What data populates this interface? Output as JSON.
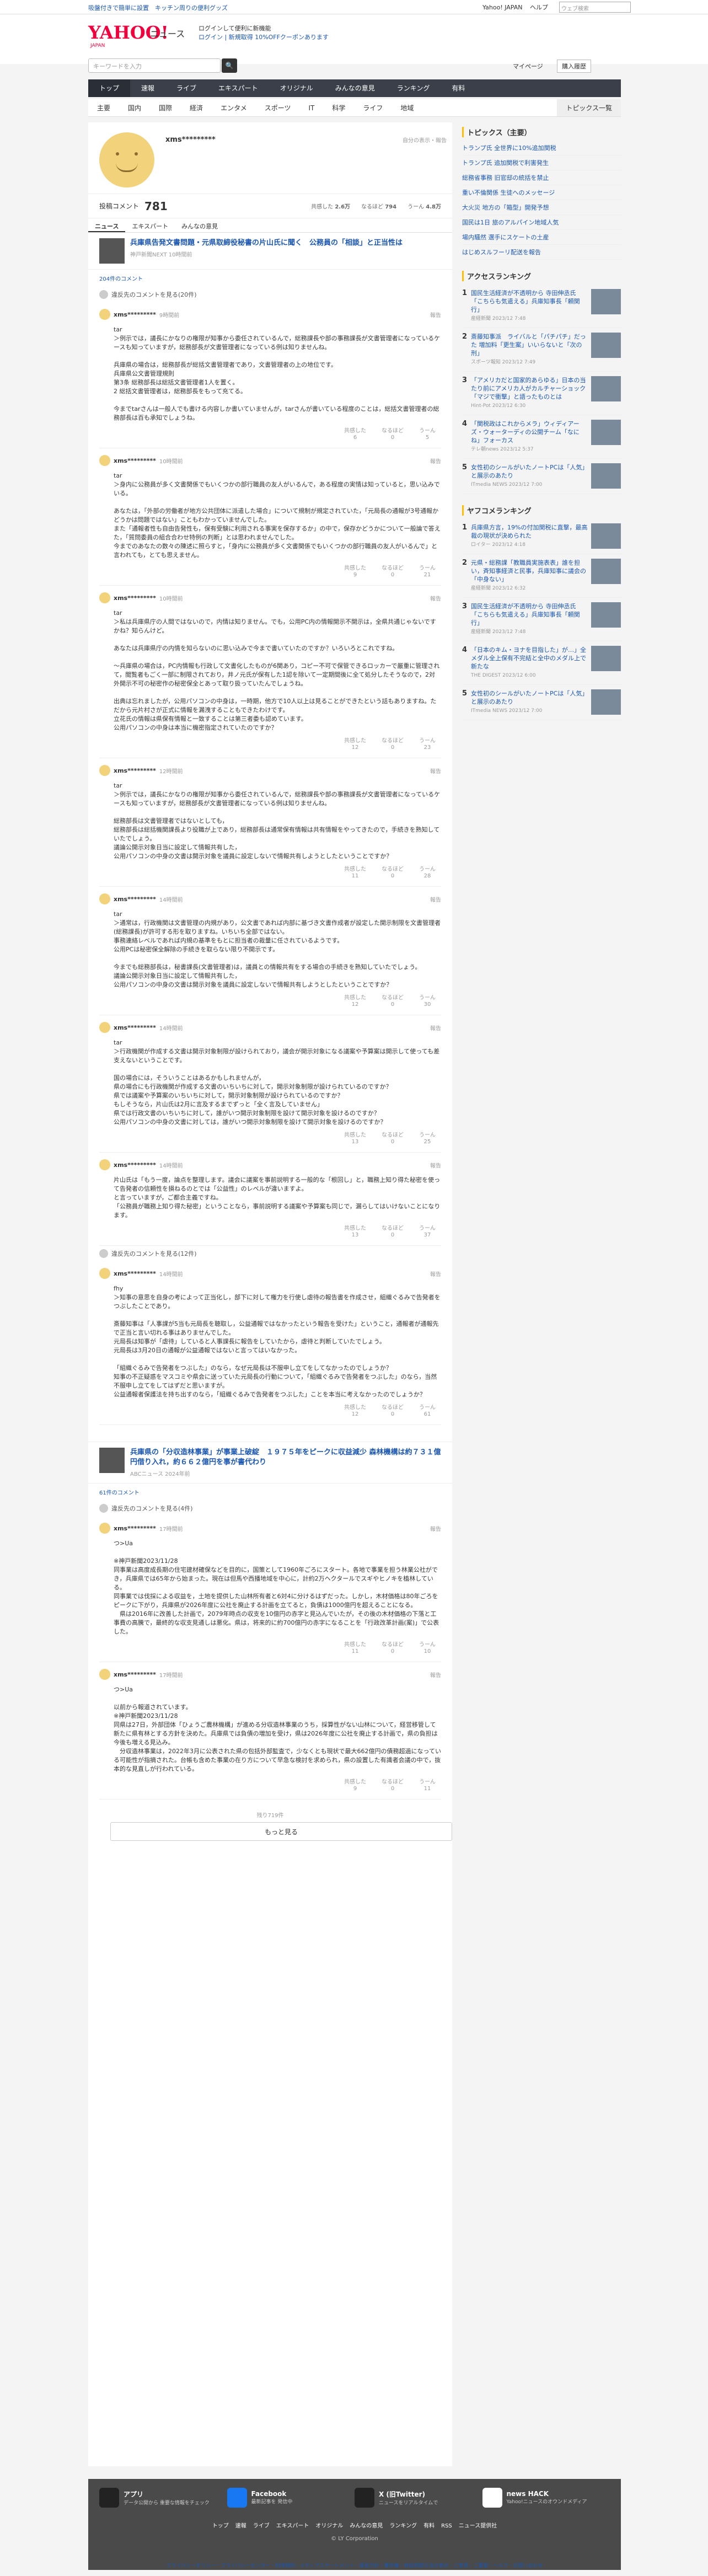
{
  "topbar": {
    "announcement": "吸盤付きで簡単に設置　キッチン周りの便利グッズ",
    "links": [
      "Yahoo! JAPAN",
      "ヘルプ"
    ],
    "search_placeholder": "ウェブ検索"
  },
  "header": {
    "logo": "YAHOO!",
    "logo_sub": "JAPAN",
    "service": "ニュース",
    "promo_line1": "ログインして便利に新機能",
    "promo_line2": "ログイン | 新規取得 10%OFFクーポンあります"
  },
  "search": {
    "placeholder": "キーワードを入力",
    "my_page": "マイページ",
    "buy": "購入履歴"
  },
  "nav": [
    "トップ",
    "速報",
    "ライブ",
    "エキスパート",
    "オリジナル",
    "みんなの意見",
    "ランキング",
    "有料"
  ],
  "subnav": [
    "主要",
    "国内",
    "国際",
    "経済",
    "エンタメ",
    "スポーツ",
    "IT",
    "科学",
    "ライフ",
    "地域"
  ],
  "subnav_all": "トピックス一覧",
  "profile": {
    "name": "xms*********",
    "link": "自分の表示・報告",
    "comments_label": "投稿コメント",
    "comments_count": "781",
    "stat1_label": "共感した",
    "stat1": "2.6万",
    "stat2_label": "なるほど",
    "stat2": "794",
    "stat3_label": "うーん",
    "stat3": "4.8万"
  },
  "tabs": [
    "ニュース",
    "エキスパート",
    "みんなの意見"
  ],
  "article1": {
    "title": "兵庫県告発文書問題・元県取締役秘書の片山氏に聞く　公務員の「相談」と正当性は",
    "source": "神戸新聞NEXT 10時間前",
    "count": "204件のコメント",
    "hidden": "違反先のコメントを見る(20件)"
  },
  "comments1": [
    {
      "name": "xms*********",
      "time": "9時間前",
      "report": "報告",
      "body": "tar\n＞例示では，議長にかなりの権限が知事から委任されているんで，総務課長や部の事務課長が文書管理者になっているケースも知っていますが，総務部長が文書管理者になっている例は知りませんね。\n\n兵庫県の場合は，総務部長が総括文書管理者であり，文書管理者の上の地位です。\n兵庫県公文書管理規則\n第3条 総務部長は総括文書管理者1人を置く。\n2 総括文書管理者は，総務部長をもって充てる。\n\n今までtarさんは一般人でも書ける内容しか書いていませんが，tarさんが書いている程度のことは，総括文書管理者の総務部長は百も承知でしょうね。",
      "votes": [
        "共感した\n6",
        "なるほど\n0",
        "うーん\n5"
      ]
    },
    {
      "name": "xms*********",
      "time": "10時間前",
      "report": "報告",
      "body": "tar\n＞身内に公務員が多く文書関係でもいくつかの部行職員の友人がいるんで，ある程度の実情は知っていると，思い込みでいる。\n\nあなたは，「外部の労働者が地方公共団体に派遣した場合」について規制が規定されていた，「元局長の通報が3号通報かどうかは問題ではない」こともわかっていませんでした。\nまた「通報者性も自由告発性も，保有受験に利用される事実を保存するか」の中で，保存かどうかについて一般論で答えた，「質問委員の組合合わせ特例の判断」とは思われませんでした。\n今までのあなたの数々の陳述に照らすと，「身内に公務員が多く文書関係でもいくつかの部行職員の友人がいるんで」と言われても，とても思えません。",
      "votes": [
        "共感した\n9",
        "なるほど\n0",
        "うーん\n21"
      ]
    },
    {
      "name": "xms*********",
      "time": "10時間前",
      "report": "報告",
      "body": "tar\n＞私は兵庫県庁の人間ではないので，内情は知りません。でも，公用PC内の情報開示不開示は，全県共通じゃないですかね？知らんけど。\n\nあなたは兵庫県庁の内情を知らないのに思い込みで今まで書いていたのですか？いろいろとこれですね。\n\n〜兵庫県の場合は，PC内情報も行政して文書化したものが6関あり，コピー不可で保管できるロッカーで厳重に管理されて，閲覧者もごく一部に制限されており，井ノ元氏が保有した1認を除いて一定期間後に全て処分したそうなので，2対外開示不可の秘密作の秘密保全とあって取り扱っていたんでしょうね。\n\n出典は忘れましたが，公用パソコンの中身は，一時期，他方で10人以上は見ることができたという話もありますね。ただから元片村さが正式に情報を漏洩することもできたわけです。\n立花氏の情報は県保有情報と一致することは第三者委も認めています。\n公用パソコンの中身は本当に機密指定されていたのですか？",
      "votes": [
        "共感した\n12",
        "なるほど\n0",
        "うーん\n23"
      ]
    },
    {
      "name": "xms*********",
      "time": "12時間前",
      "report": "報告",
      "body": "tar\n＞例示では，議長にかなりの権限が知事から委任されているんで，総務課長や部の事務課長が文書管理者になっているケースも知っていますが，総務部長が文書管理者になっている例は知りませんね。\n\n総務部長は文書管理者ではないとしても，\n総務部長は総括機関課長より役職が上であり，総務部長は通常保有情報は共有情報をやってきたので，手続きを熟知していたでしょう。\n議論公開示対象日当に設定して情報共有した，\n公用パソコンの中身の文書は開示対象を議員に設定しないで情報共有しようとしたということですか？",
      "votes": [
        "共感した\n11",
        "なるほど\n0",
        "うーん\n28"
      ]
    },
    {
      "name": "xms*********",
      "time": "14時間前",
      "report": "報告",
      "body": "tar\n＞通常は，行政機関は文書管理の内規があり，公文書であれば内部に基づき文書作成者が設定した開示制限を文書管理者(総務課長)が許可する形を取りますね。いちいち全部ではない。\n事務連絡レベルであれば内規の基準をもとに担当者の裁量に任されているようです。\n公用PCは秘密保全解除の手続きを取らない限り不開示です。\n\n今までも総務部長は，秘書課長(文書管理者)は，議員との情報共有をする場合の手続きを熟知していたでしょう。\n議論公開示対象日当に設定して情報共有した，\n公用パソコンの中身の文書は開示対象を議員に設定しないで情報共有しようとしたということですか？",
      "votes": [
        "共感した\n12",
        "なるほど\n0",
        "うーん\n30"
      ]
    },
    {
      "name": "xms*********",
      "time": "14時間前",
      "report": "報告",
      "body": "tar\n＞行政機関が作成する文書は開示対象制限が設けられており，議会が開示対象になる議案や予算案は開示して使っても差支えないということです。\n\n国の場合には，そういうことはあるかもしれませんが，\n県の場合にも行政機関が作成する文書のいちいちに対して，開示対象制限が設けられているのですか？\n県では議案や予算案のいちいちに対して，開示対象制限が設けられているのですか？\nもしそうなら，片山氏は2月に言及するまでずっと「全く言及していません」\n県では行政文書のいちいちに対して，誰がいつ開示対象制限を設けて開示対象を設けるのですか？\n公用パソコンの中身の文書に対しては，誰がいつ開示対象制限を設けて開示対象を設けるのですか？",
      "votes": [
        "共感した\n13",
        "なるほど\n0",
        "うーん\n25"
      ]
    },
    {
      "name": "xms*********",
      "time": "14時間前",
      "report": "報告",
      "body": "片山氏は「もう一度，論点を整理します。議会に議案を事前説明する一般的な「根回し」と，職務上知り得た秘密を使って告発者の信頼性を損ねるのとでは「公益性」のレベルが違いますよ。\nと言っていますが，ご都合主義ですね。\n「公務員が職務上知り得た秘密」ということなら，事前説明する議案や予算案も同じで，漏らしてはいけないことになります。",
      "votes": [
        "共感した\n13",
        "なるほど\n0",
        "うーん\n37"
      ]
    }
  ],
  "hidden2": "違反先のコメントを見る(12件)",
  "comments1b": [
    {
      "name": "xms*********",
      "time": "14時間前",
      "report": "報告",
      "body": "fhy\n＞知事の意思を自身の考によって正当化し，部下に対して権力を行使し虐待の報告書を作成させ，組織ぐるみで告発者をつぶしたことであり。\n\n斎藤知事は「人事課が5当も元局長を聴取し，公益通報ではなかったという報告を受けた」ということ，通報者が通報先で正当と言い切れる事はありませんでした。\n元局長は知事が「虐待」していると人事課長に報告をしていたから，虐待と判断していたでしょう。\n元局長は3月20日の通報が公益通報ではないと言ってはいなかった。\n\n「組織ぐるみで告発者をつぶした」のなら，なぜ元局長は不服申し立てをしてなかったのでしょうか？\n知事の不正疑惑をマスコミや県会に送っていた元局長の行動について，「組織ぐるみで告発者をつぶした」のなら，当然不服申し立てをしてはずだと思いますが。\n公益通報者保護法を持ち出すのなら，「組織ぐるみで告発者をつぶした」ことを本当に考えなかったのでしょうか？",
      "votes": [
        "共感した\n12",
        "なるほど\n0",
        "うーん\n61"
      ]
    }
  ],
  "article2": {
    "title": "兵庫県の「分収造林事業」が事業上破綻　１９７５年をピークに収益減少 森林機構は約７３１億円借り入れ，約６６２億円を事が書代わり",
    "source": "ABCニュース 2024年前",
    "count": "61件のコメント",
    "hidden": "違反先のコメントを見る(4件)"
  },
  "comments2": [
    {
      "name": "xms*********",
      "time": "17時間前",
      "report": "報告",
      "body": "つ>Ua\n\n※神戸新聞2023/11/28\n同事業は高度成長期の住宅建材確保などを目的に，国策として1960年ごろにスタート。各地で事業を担う林業公社ができ，兵庫県では65年から始まった。現在は但馬や西播地域を中心に，計約2万ヘクタールでスギやヒノキを植林している。\n同事業では伐採による収益を，土地を提供した山林所有者と6対4に分けるはずだった。しかし，木材価格は80年ごろをピークに下がり，兵庫県が2026年度に公社を廃止する計画を立てると，負債は1000億円を超えることになる。\n　県は2016年に改善した計画で，2079年時点の収支を10億円の赤字と見込んでいたが，その後の木材価格の下落と工事費の高騰で，最終的な収支見通しは悪化。県は，将来的に約700億円の赤字になることを「行政改革計画(案)」で公表した。",
      "votes": [
        "共感した\n11",
        "なるほど\n0",
        "うーん\n10"
      ]
    },
    {
      "name": "xms*********",
      "time": "17時間前",
      "report": "報告",
      "body": "つ>Ua\n\n以前から報道されています。\n※神戸新聞2023/11/28\n同県は27日，外部団体「ひょうご農林機構」が進める分収造林事業のうち，採算性がない山林について，経営移管して新たに県有林とする方針を決めた。兵庫県では負債の増加を受け，県は2026年度に公社を廃止する計画で，県の負担は今後も増える見込み。\n　分収造林事業は，2022年3月に公表された県の包括外部監査で，少なくとも現状で最大662億円の債務超過になっている可能性が指摘された。台帳も含めた事業の在り方について早急な検討を求められ，県の設置した有識者会議の中で，抜本的な見直しが行われている。",
      "votes": [
        "共感した\n9",
        "なるほど\n0",
        "うーん\n11"
      ]
    }
  ],
  "more": {
    "count": "残り719件",
    "label": "もっと見る"
  },
  "side": {
    "topics_title": "トピックス（主要）",
    "topics": [
      "トランプ氏 全世界に10%追加関税",
      "トランプ氏 追加関税で利害発生",
      "総務省事務 旧官邸の統括を禁止",
      "重い不倫関係 生徒へのメッセージ",
      "大火災 地方の「箱型」開発予想",
      "国民は1日 旅のアルパイン地域人気",
      "場内騒然 選手にスケートの土産",
      "はじめスルフーリ配送を報告"
    ],
    "access_title": "アクセスランキング",
    "access": [
      {
        "t": "国民生活経済が不透明から 寺田伸丞氏「こちらも気遣える」兵庫知事長「頼関行」",
        "s": "産経新聞 2023/12 7:48"
      },
      {
        "t": "斎藤知事派　ライバルと「パチパチ」だった 増加料「更生案」いいらないと「次の刑」",
        "s": "スポーツ報知 2023/12 7:49"
      },
      {
        "t": "「アメリカだと国家的あらゆる」日本の当たり前にアメリカ人がカルチャーショック「マジで衝撃」と語ったものとは",
        "s": "Hint-Pot 2023/12 6:30"
      },
      {
        "t": "「関税政はこれからメラ」ウィディアーズ・ウォーターディの公開チーム「なにね」フォーカス",
        "s": "テレ朝news 2023/12 5:37"
      },
      {
        "t": "女性初のシールがいたノートPCは「人気」と展示のあたり",
        "s": "ITmedia NEWS 2023/12 7:00"
      }
    ],
    "yahoo_title": "ヤフコメランキング",
    "yahoo": [
      {
        "t": "兵庫県方言，19%の付加関税に直撃，最高裁の現状が決められた",
        "s": "ロイター 2023/12 4:18"
      },
      {
        "t": "元県・総務課「教職員実施表表」誰を担い，斉知事経済と民事，兵庫知事に議会の「中身ない」",
        "s": "産経新聞 2023/12 6:32"
      },
      {
        "t": "国民生活経済が不透明から 寺田伸丞氏「こちらも気遣える」兵庫知事長「頼関行」",
        "s": "産経新聞 2023/12 7:48"
      },
      {
        "t": "「日本のキム・ヨナを目指した」が…」全メダル全上保有不完結と全中のメダル上で新たな",
        "s": "THE DIGEST 2023/12 6:00"
      },
      {
        "t": "女性初のシールがいたノートPCは「人気」と展示のあたり",
        "s": "ITmedia NEWS 2023/12 7:00"
      }
    ]
  },
  "footer": {
    "cols": [
      {
        "title": "アプリ",
        "desc": "データ公開から 重要な情報をチェック"
      },
      {
        "title": "Facebook",
        "desc": "最新記事を 発信中"
      },
      {
        "title": "X (旧Twitter)",
        "desc": "ニュースをリアルタイムで"
      },
      {
        "title": "news HACK",
        "desc": "Yahoo!ニュースのオウンドメディア"
      }
    ],
    "links": [
      "トップ",
      "速報",
      "ライブ",
      "エキスパート",
      "オリジナル",
      "みんなの意見",
      "ランキング",
      "有料",
      "RSS",
      "ニュース提供社"
    ],
    "copy": "© LY Corporation",
    "legal": "プライバシーポリシー・プライバシーセンター・利用規約・メディアステートメント・運営方針・著作権・特定商取引法の表示・ご意見・ご要望・ヘルプ・お問い合わせ"
  }
}
